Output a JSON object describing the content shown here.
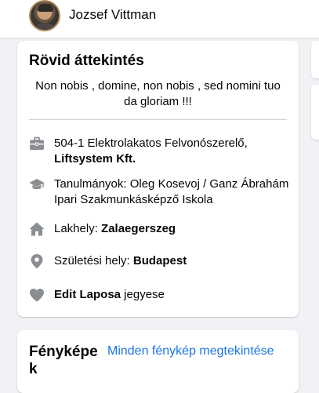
{
  "header": {
    "user_name": "Jozsef Vittman",
    "avatar_icon": "profile-photo"
  },
  "intro": {
    "title": "Rövid áttekintés",
    "bio": "Non nobis , domine, non nobis , sed nomini tuo da gloriam !!!",
    "items": [
      {
        "icon": "briefcase-icon",
        "prefix": "504-1 Elektrolakatos Felvonószerelő,",
        "bold": "Liftsystem Kft.",
        "suffix": ""
      },
      {
        "icon": "graduation-cap-icon",
        "prefix": "Tanulmányok: Oleg Kosevoj / Ganz Ábrahám Ipari Szakmunkásképző Iskola",
        "bold": "",
        "suffix": ""
      },
      {
        "icon": "home-icon",
        "prefix": "Lakhely: ",
        "bold": "Zalaegerszeg",
        "suffix": ""
      },
      {
        "icon": "location-pin-icon",
        "prefix": "Születési hely: ",
        "bold": "Budapest",
        "suffix": ""
      },
      {
        "icon": "heart-icon",
        "prefix": "",
        "bold": "Edit Laposa",
        "suffix": " jegyese"
      }
    ]
  },
  "photos": {
    "title": "Fényképek",
    "link": "Minden fénykép megtekintése"
  },
  "colors": {
    "background": "#f0f2f5",
    "card": "#ffffff",
    "link": "#1b74e4",
    "icon": "#8a8d91"
  }
}
